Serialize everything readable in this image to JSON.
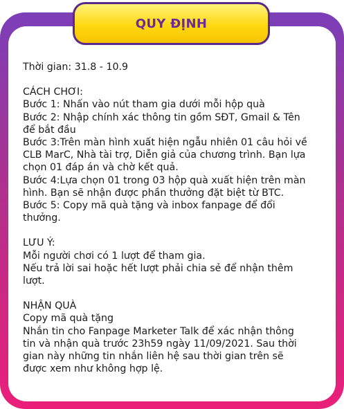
{
  "title": "QUY ĐỊNH",
  "time": "Thời gian: 31.8 - 10.9",
  "how_to_play": {
    "heading": "CÁCH CHƠI:",
    "lines": [
      "Bước 1: Nhấn vào nút tham gia dưới mỗi hộp quà",
      "Bước 2: Nhập chính xác thông tin gồm SĐT, Gmail & Tên",
      "để bắt đầu",
      "Bước 3:Trên màn hình xuất hiện ngẫu nhiên 01 câu hỏi về",
      "CLB MarC, Nhà tài trợ, Diễn giả của chương trình. Bạn lựa",
      "chọn 01 đáp án và chờ kết quả.",
      "Bước 4:Lựa chọn 01 trong 03 hộp quà xuất hiện trên màn",
      "hình. Bạn sẽ nhận được phần thưởng đặt biệt từ BTC.",
      "Bước 5: Copy mã quà tặng và inbox fanpage để đổi",
      "thưởng."
    ]
  },
  "notes": {
    "heading": "LƯU Ý:",
    "lines": [
      "Mỗi người chơi có 1 lượt để tham gia.",
      "Nếu trả lời sai hoặc hết lượt phải chia sẻ để nhận thêm",
      "lượt."
    ]
  },
  "receive": {
    "heading": "NHẬN QUÀ",
    "lines": [
      "Copy mã quà tặng",
      "Nhắn tin cho Fanpage Marketer Talk để xác nhận thông",
      "tin và nhận quà trước 23h59 ngày 11/09/2021. Sau thời",
      "gian này những tin nhắn liên hệ sau thời gian trên sẽ",
      "được xem như không hợp lệ."
    ]
  }
}
